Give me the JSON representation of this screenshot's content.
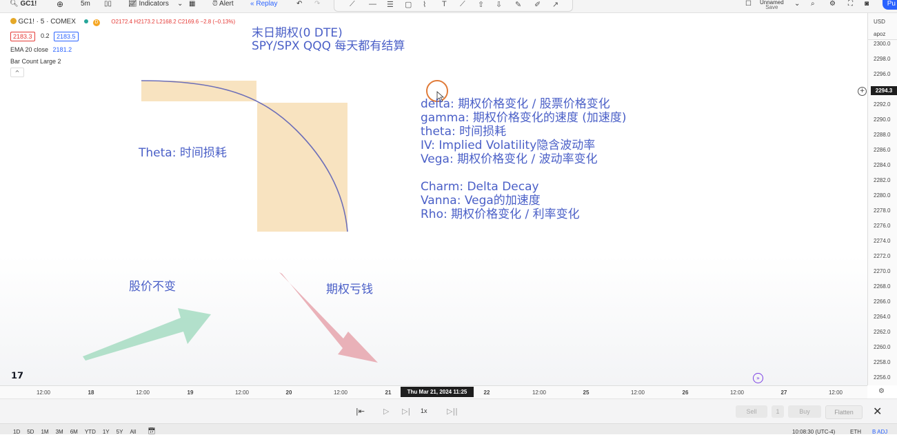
{
  "toolbar": {
    "symbol": "GC1!",
    "interval": "5m",
    "indicators_label": "Indicators",
    "alert_label": "Alert",
    "replay_label": "Replay",
    "layout_name": "Unnamed",
    "save_label": "Save",
    "publish_label": "Pu"
  },
  "legend": {
    "title": "GC1! · 5 · COMEX",
    "status_letter": "D",
    "ohlc": "O2172.4  H2173.2  L2168.2  C2169.6  −2.8 (−0.13%)",
    "bid": "2183.3",
    "spread": "0.2",
    "ask": "2183.5",
    "ema_label": "EMA 20 close",
    "ema_value": "2181.2",
    "bar_count": "Bar Count Large 2",
    "collapse": "^"
  },
  "annotations": {
    "header_line1": "末日期权(0 DTE)",
    "header_line2": "SPY/SPX  QQQ 每天都有结算",
    "theta_label": "Theta: 时间损耗",
    "greeks": [
      "delta: 期权价格变化 / 股票价格变化",
      "gamma: 期权价格变化的速度 (加速度)",
      "theta: 时间损耗",
      "IV: Implied Volatility隐含波动率",
      "Vega: 期权价格变化 / 波动率变化"
    ],
    "greeks2": [
      "Charm: Delta Decay",
      "Vanna: Vega的加速度",
      "Rho: 期权价格变化 / 利率变化"
    ],
    "stock_flat": "股价不变",
    "option_loss": "期权亏钱"
  },
  "price_axis": {
    "currency": "USD",
    "scale": "apoz",
    "labels": [
      "2300.0",
      "2298.0",
      "2296.0",
      "2292.0",
      "2290.0",
      "2288.0",
      "2286.0",
      "2284.0",
      "2282.0",
      "2280.0",
      "2278.0",
      "2276.0",
      "2274.0",
      "2272.0",
      "2270.0",
      "2268.0",
      "2266.0",
      "2264.0",
      "2262.0",
      "2260.0",
      "2258.0",
      "2256.0"
    ],
    "current_price": "2294.3"
  },
  "time_axis": {
    "labels": [
      "12:00",
      "18",
      "12:00",
      "19",
      "12:00",
      "20",
      "12:00",
      "21",
      "22",
      "12:00",
      "25",
      "12:00",
      "26",
      "12:00",
      "27",
      "12:00"
    ],
    "cursor_label": "Thu Mar 21, 2024   11:25"
  },
  "replay": {
    "speed": "1x",
    "sell": "Sell",
    "qty": "1",
    "buy": "Buy",
    "flatten": "Flatten"
  },
  "bottom": {
    "ranges": [
      "1D",
      "5D",
      "1M",
      "3M",
      "6M",
      "YTD",
      "1Y",
      "5Y",
      "All"
    ],
    "clock": "10:08:30 (UTC-4)",
    "session": "ETH",
    "adj": "B ADJ"
  },
  "colors": {
    "annotation": "#4a5fc7",
    "theta_box": "#f8e3c0",
    "green_arrow": "#a6dcc2",
    "red_arrow": "#e6a5ad"
  }
}
